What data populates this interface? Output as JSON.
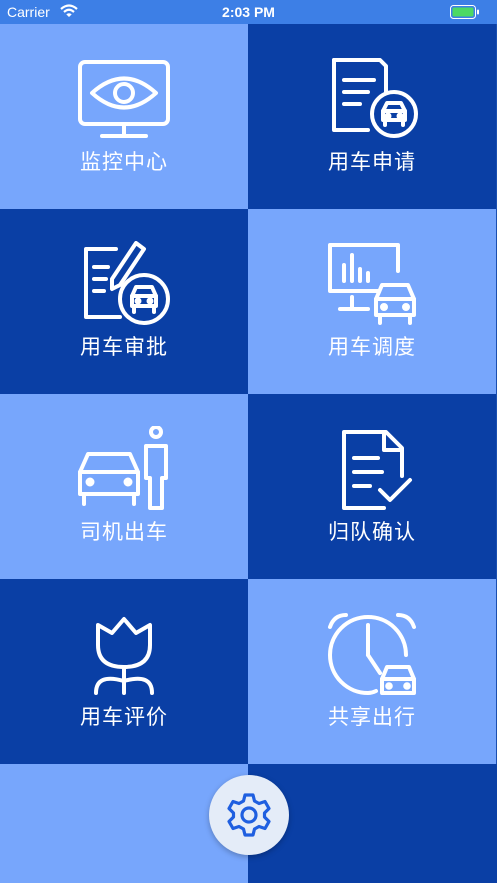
{
  "status_bar": {
    "carrier": "Carrier",
    "time": "2:03 PM"
  },
  "colors": {
    "tile_light": "#77a6fc",
    "tile_dark": "#0a3fa5",
    "status_bar": "#3d7fe6",
    "battery": "#4cd964",
    "settings_icon": "#1f5fe0"
  },
  "menu": [
    {
      "label": "监控中心",
      "icon": "monitor-eye-icon"
    },
    {
      "label": "用车申请",
      "icon": "document-car-icon"
    },
    {
      "label": "用车审批",
      "icon": "approval-pen-car-icon"
    },
    {
      "label": "用车调度",
      "icon": "chart-monitor-car-icon"
    },
    {
      "label": "司机出车",
      "icon": "car-driver-icon"
    },
    {
      "label": "归队确认",
      "icon": "document-check-icon"
    },
    {
      "label": "用车评价",
      "icon": "tulip-icon"
    },
    {
      "label": "共享出行",
      "icon": "alarm-clock-car-icon"
    }
  ],
  "settings": {
    "icon": "gear-icon"
  }
}
